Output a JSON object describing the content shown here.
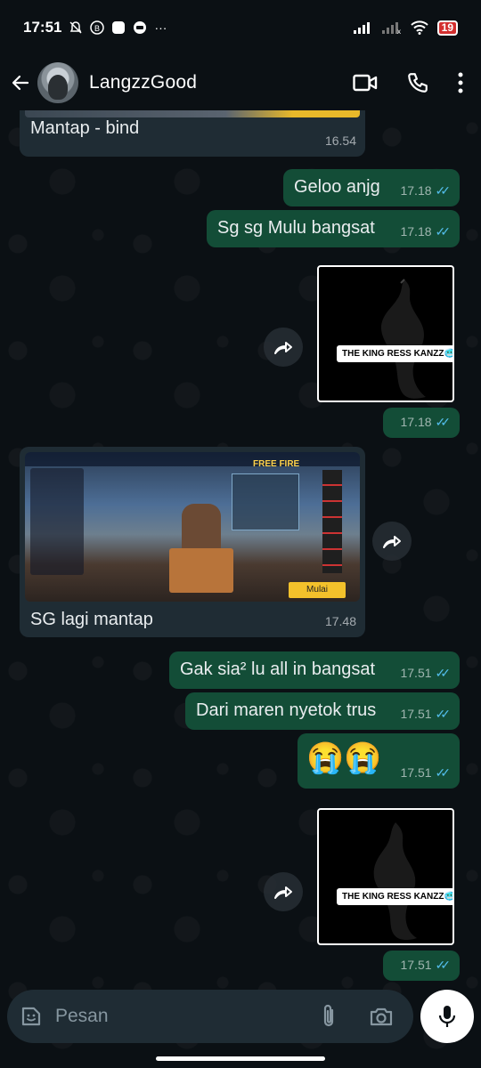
{
  "status": {
    "time": "17:51",
    "battery": "19",
    "more": "···"
  },
  "header": {
    "contact_name": "LangzzGood"
  },
  "messages": [
    {
      "id": "m1",
      "dir": "in",
      "text": "Mantap - bind",
      "time": "16.54"
    },
    {
      "id": "m2",
      "dir": "out",
      "text": "Geloo anjg",
      "time": "17.18"
    },
    {
      "id": "m3",
      "dir": "out",
      "text": "Sg sg Mulu bangsat",
      "time": "17.18"
    },
    {
      "id": "m4",
      "dir": "out",
      "type": "image",
      "caption_art": "THE KING RESS KANZZ🥶",
      "time": "17.18"
    },
    {
      "id": "m5",
      "dir": "in",
      "type": "image",
      "text": "SG lagi mantap",
      "time": "17.48",
      "game_labels": {
        "brand": "FREE FIRE",
        "start": "Mulai"
      }
    },
    {
      "id": "m6",
      "dir": "out",
      "text": "Gak sia² lu all in bangsat",
      "time": "17.51"
    },
    {
      "id": "m7",
      "dir": "out",
      "text": "Dari maren nyetok trus",
      "time": "17.51"
    },
    {
      "id": "m8",
      "dir": "out",
      "text": "😭😭",
      "time": "17.51"
    },
    {
      "id": "m9",
      "dir": "out",
      "type": "image",
      "caption_art": "THE KING RESS KANZZ🥶",
      "time": "17.51"
    }
  ],
  "composer": {
    "placeholder": "Pesan"
  },
  "colors": {
    "incoming": "#1f2c34",
    "outgoing": "#134d37",
    "tick": "#53bdeb",
    "background": "#0b1014"
  }
}
